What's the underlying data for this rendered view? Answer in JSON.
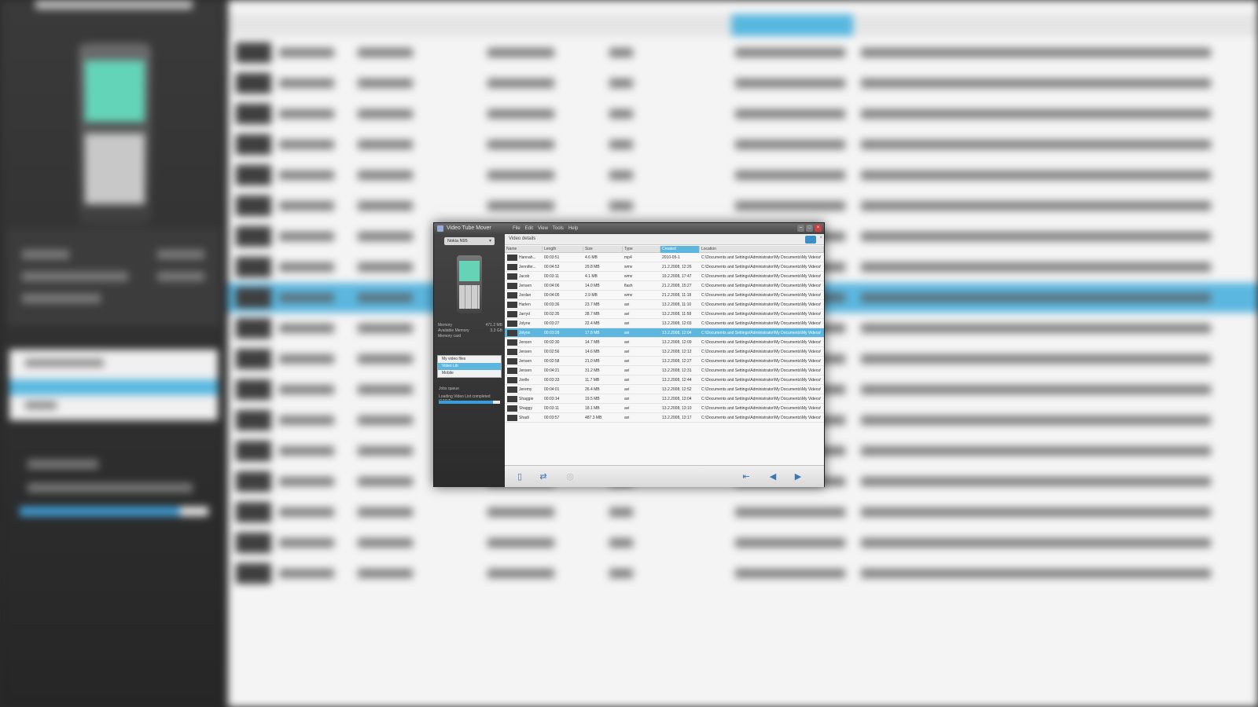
{
  "window": {
    "title": "Video Tube Mover",
    "menu": [
      "File",
      "Edit",
      "View",
      "Tools",
      "Help"
    ],
    "controls": {
      "min": "–",
      "max": "□",
      "close": "×"
    }
  },
  "sidebar": {
    "device_select": "Nokia N95",
    "info": [
      {
        "label": "Memory",
        "value": "471.2 MB"
      },
      {
        "label": "Available Memory",
        "value": "3.3 GB"
      },
      {
        "label": "Memory card",
        "value": ""
      }
    ],
    "library": [
      {
        "label": "My video files",
        "selected": false
      },
      {
        "label": "Video Lib",
        "selected": true
      },
      {
        "label": "Mobile",
        "selected": false
      }
    ],
    "jobs_label": "Jobs queue",
    "status": "Loading Video List completed (17/17)",
    "progress": 0.88
  },
  "main": {
    "breadcrumb": "Video details",
    "columns": [
      "Name",
      "Length",
      "Size",
      "Type",
      "Created",
      "Location"
    ],
    "sorted_column": 4,
    "rows": [
      {
        "name": "Hannah...",
        "length": "00:03:51",
        "size": "4.6 MB",
        "type": "mp4",
        "created": "2010-05-1",
        "location": "C:\\Documents and Settings\\Administrator\\My Documents\\My Videos\\...",
        "selected": false
      },
      {
        "name": "Jennifer...",
        "length": "00:04:53",
        "size": "29.8 MB",
        "type": "wmv",
        "created": "21.2.2008, 12:26",
        "location": "C:\\Documents and Settings\\Administrator\\My Documents\\My Videos\\...",
        "selected": false
      },
      {
        "name": "Jacob",
        "length": "00:03:11",
        "size": "4.1 MB",
        "type": "wmv",
        "created": "19.2.2008, 17:47",
        "location": "C:\\Documents and Settings\\Administrator\\My Documents\\My Videos\\...",
        "selected": false
      },
      {
        "name": "Jensen",
        "length": "00:04:06",
        "size": "14.0 MB",
        "type": "flash",
        "created": "21.2.2008, 15:27",
        "location": "C:\\Documents and Settings\\Administrator\\My Documents\\My Videos\\...",
        "selected": false
      },
      {
        "name": "Jordan",
        "length": "00:04:05",
        "size": "2.9 MB",
        "type": "wmv",
        "created": "21.2.2008, 11:18",
        "location": "C:\\Documents and Settings\\Administrator\\My Documents\\My Videos\\...",
        "selected": false
      },
      {
        "name": "Harlen",
        "length": "00:03:36",
        "size": "23.7 MB",
        "type": "avi",
        "created": "13.2.2008, 11:10",
        "location": "C:\\Documents and Settings\\Administrator\\My Documents\\My Videos\\...",
        "selected": false
      },
      {
        "name": "Jarryd",
        "length": "00:02:35",
        "size": "28.7 MB",
        "type": "avi",
        "created": "13.2.2008, 11:58",
        "location": "C:\\Documents and Settings\\Administrator\\My Documents\\My Videos\\...",
        "selected": false
      },
      {
        "name": "Jolyne",
        "length": "00:03:27",
        "size": "22.4 MB",
        "type": "avi",
        "created": "13.2.2008, 12:03",
        "location": "C:\\Documents and Settings\\Administrator\\My Documents\\My Videos\\...",
        "selected": false
      },
      {
        "name": "Jolynn",
        "length": "00:03:28",
        "size": "17.8 MB",
        "type": "avi",
        "created": "13.2.2008, 12:04",
        "location": "C:\\Documents and Settings\\Administrator\\My Documents\\My Videos\\...",
        "selected": true
      },
      {
        "name": "Jenson",
        "length": "00:02:30",
        "size": "14.7 MB",
        "type": "avi",
        "created": "13.2.2008, 12:09",
        "location": "C:\\Documents and Settings\\Administrator\\My Documents\\My Videos\\...",
        "selected": false
      },
      {
        "name": "Jensen",
        "length": "00:02:56",
        "size": "14.6 MB",
        "type": "avi",
        "created": "13.2.2008, 12:12",
        "location": "C:\\Documents and Settings\\Administrator\\My Documents\\My Videos\\...",
        "selected": false
      },
      {
        "name": "Jensen",
        "length": "00:02:58",
        "size": "21.0 MB",
        "type": "avi",
        "created": "13.2.2008, 12:27",
        "location": "C:\\Documents and Settings\\Administrator\\My Documents\\My Videos\\...",
        "selected": false
      },
      {
        "name": "Jensen",
        "length": "00:04:21",
        "size": "31.2 MB",
        "type": "avi",
        "created": "13.2.2008, 12:31",
        "location": "C:\\Documents and Settings\\Administrator\\My Documents\\My Videos\\...",
        "selected": false
      },
      {
        "name": "Joelle",
        "length": "00:03:33",
        "size": "11.7 MB",
        "type": "avi",
        "created": "13.2.2008, 12:44",
        "location": "C:\\Documents and Settings\\Administrator\\My Documents\\My Videos\\...",
        "selected": false
      },
      {
        "name": "Jeremy",
        "length": "00:04:01",
        "size": "26.4 MB",
        "type": "avi",
        "created": "13.2.2008, 12:52",
        "location": "C:\\Documents and Settings\\Administrator\\My Documents\\My Videos\\...",
        "selected": false
      },
      {
        "name": "Shaggie",
        "length": "00:03:14",
        "size": "19.5 MB",
        "type": "avi",
        "created": "13.2.2008, 13:04",
        "location": "C:\\Documents and Settings\\Administrator\\My Documents\\My Videos\\...",
        "selected": false
      },
      {
        "name": "Shaggy",
        "length": "00:03:11",
        "size": "18.1 MB",
        "type": "avi",
        "created": "13.2.2008, 13:10",
        "location": "C:\\Documents and Settings\\Administrator\\My Documents\\My Videos\\...",
        "selected": false
      },
      {
        "name": "Shadi",
        "length": "00:03:57",
        "size": "487.3 MB",
        "type": "avi",
        "created": "13.2.2008, 13:17",
        "location": "C:\\Documents and Settings\\Administrator\\My Documents\\My Videos\\...",
        "selected": false
      }
    ]
  },
  "toolbar": {
    "phone_icon": "▯",
    "transfer_icon": "⇄",
    "disabled_icon": "◎",
    "back_all_icon": "⇤",
    "back_icon": "◀",
    "forward_icon": "▶"
  }
}
